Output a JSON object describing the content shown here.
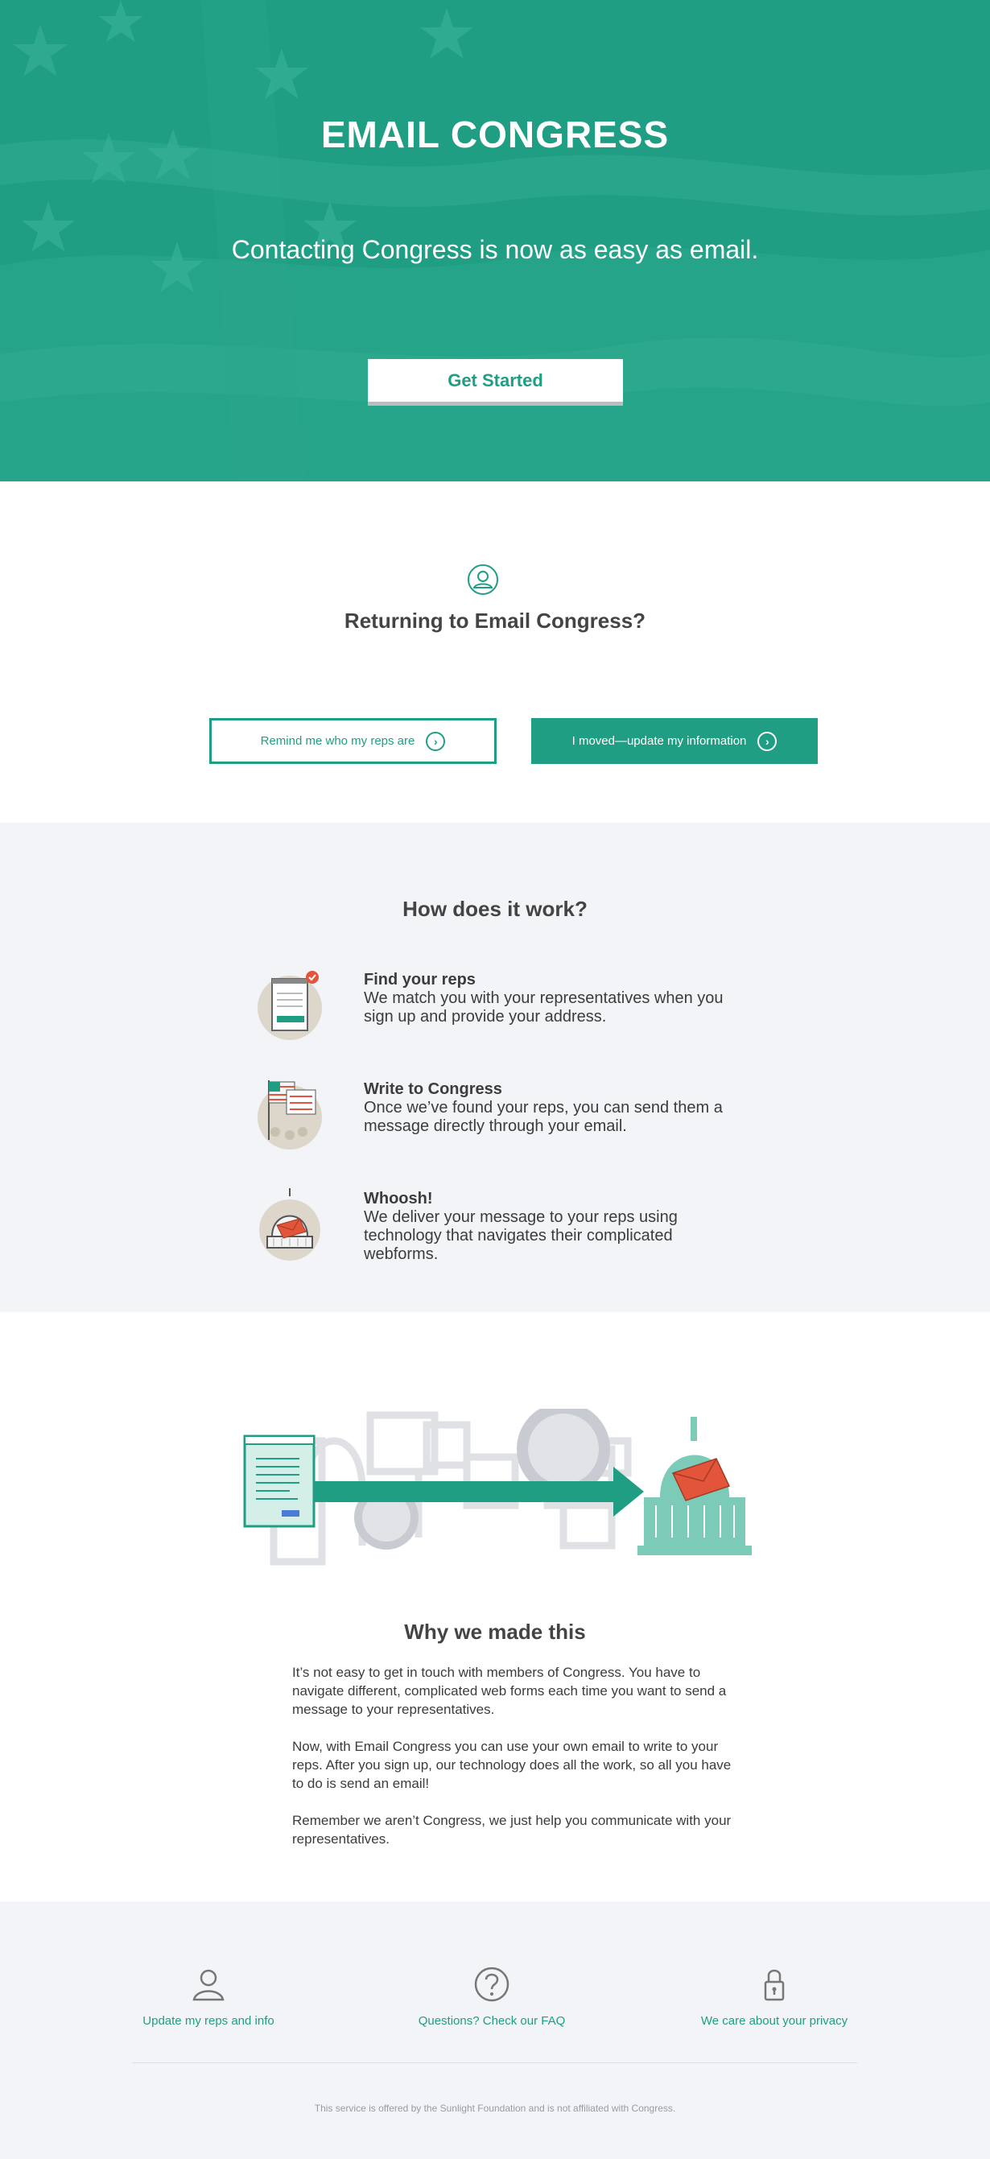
{
  "hero": {
    "title": "EMAIL CONGRESS",
    "subtitle": "Contacting Congress is now as easy as email.",
    "cta_label": "Get Started"
  },
  "returning": {
    "title": "Returning to Email Congress?",
    "remind_label": "Remind me who my reps are",
    "moved_label": "I moved—update my information",
    "chevron": "›"
  },
  "how": {
    "title": "How does it work?",
    "steps": [
      {
        "title": "Find your reps",
        "desc": "We match you with your representatives when you sign up and provide your address.",
        "icon": "find-reps-icon"
      },
      {
        "title": "Write to Congress",
        "desc": "Once we’ve found your reps, you can send them a message directly through your email.",
        "icon": "flag-letter-icon"
      },
      {
        "title": "Whoosh!",
        "desc": "We deliver your message to your reps using technology that navigates their complicated webforms.",
        "icon": "capitol-envelope-icon"
      }
    ]
  },
  "why": {
    "title": "Why we made this",
    "paragraphs": [
      "It’s not easy to get in touch with members of Congress. You have to navigate different, complicated web forms each time you want to send a message to your representatives.",
      "Now, with Email Congress you can use your own email to write to your reps. After you sign up, our technology does all the work, so all you have to do is send an email!",
      "Remember we aren’t Congress, we just help you communicate with your representatives."
    ]
  },
  "footer": {
    "links": [
      {
        "label": "Update my reps and info",
        "icon": "user-icon"
      },
      {
        "label": "Questions? Check our FAQ",
        "icon": "question-icon"
      },
      {
        "label": "We care about your privacy",
        "icon": "lock-icon"
      }
    ],
    "note": "This service is offered by the Sunlight Foundation and is not affiliated with Congress."
  },
  "colors": {
    "brand_teal": "#1f9e83",
    "light_gray_bg": "#f3f4f7",
    "accent_red": "#e2553a"
  }
}
